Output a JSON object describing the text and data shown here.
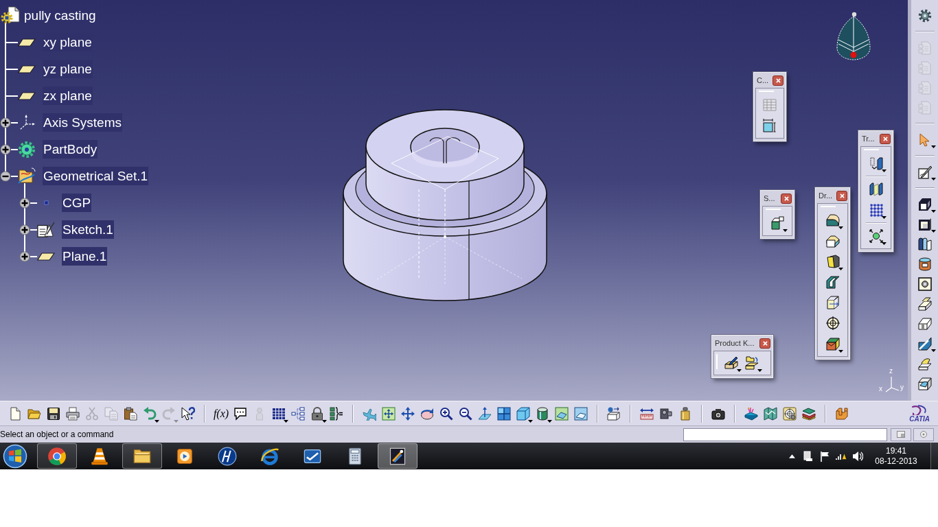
{
  "tree": {
    "label": "pully casting",
    "kind": "part",
    "children": [
      {
        "label": "xy plane",
        "kind": "plane"
      },
      {
        "label": "yz plane",
        "kind": "plane"
      },
      {
        "label": "zx plane",
        "kind": "plane"
      },
      {
        "label": "Axis Systems",
        "kind": "axis_system",
        "expanded": false
      },
      {
        "label": "PartBody",
        "kind": "body",
        "expanded": false
      },
      {
        "label": "Geometrical Set.1",
        "kind": "geometrical_set",
        "expanded": true,
        "children": [
          {
            "label": "CGP",
            "kind": "point",
            "expanded": false
          },
          {
            "label": "Sketch.1",
            "kind": "sketch",
            "expanded": false
          },
          {
            "label": "Plane.1",
            "kind": "plane",
            "expanded": false
          }
        ]
      }
    ]
  },
  "axis_triad": {
    "labels": [
      "z",
      "x",
      "y"
    ]
  },
  "floating_toolbars": [
    {
      "title": "C..."
    },
    {
      "title": "S..."
    },
    {
      "title": "Dr..."
    },
    {
      "title": "Tr..."
    },
    {
      "title": "Product K..."
    }
  ],
  "side_toolbar": [
    [
      {
        "disabled": false
      }
    ],
    [
      {
        "disabled": true
      },
      {
        "disabled": true
      },
      {
        "disabled": true
      },
      {
        "disabled": true
      }
    ],
    [
      {
        "disabled": false
      }
    ],
    [
      {
        "disabled": false
      }
    ],
    [
      {
        "disabled": false
      },
      {
        "disabled": false
      },
      {
        "disabled": false
      },
      {
        "disabled": false
      },
      {
        "disabled": false
      },
      {
        "disabled": false
      },
      {
        "disabled": false
      },
      {
        "disabled": false
      },
      {
        "disabled": false
      },
      {
        "disabled": false
      }
    ]
  ],
  "bottom_toolbar": {
    "groups": [
      [
        {
          "disabled": false
        },
        {
          "disabled": false
        },
        {
          "disabled": false
        },
        {
          "disabled": false
        },
        {
          "disabled": true
        },
        {
          "disabled": true
        },
        {
          "disabled": false
        },
        {
          "disabled": false
        },
        {
          "disabled": true
        },
        {
          "disabled": false
        }
      ],
      [
        {
          "label": "f(x)",
          "disabled": false
        },
        {
          "disabled": false
        },
        {
          "disabled": true
        },
        {
          "disabled": false
        },
        {
          "disabled": false
        },
        {
          "disabled": false
        },
        {
          "disabled": false
        }
      ],
      [
        {
          "disabled": false
        },
        {
          "disabled": false
        },
        {
          "disabled": false
        },
        {
          "disabled": false
        },
        {
          "disabled": false
        },
        {
          "disabled": false
        },
        {
          "disabled": false
        },
        {
          "disabled": false
        },
        {
          "disabled": false
        },
        {
          "disabled": false
        },
        {
          "disabled": false
        },
        {
          "disabled": false
        }
      ],
      [
        {
          "disabled": false
        }
      ],
      [
        {
          "disabled": false
        },
        {
          "disabled": false
        },
        {
          "disabled": false
        }
      ],
      [
        {
          "disabled": false
        }
      ],
      [
        {
          "disabled": false
        },
        {
          "disabled": false
        },
        {
          "disabled": false
        },
        {
          "disabled": false
        }
      ],
      [
        {
          "disabled": false
        }
      ]
    ],
    "logo": "CATIA"
  },
  "status_bar": {
    "prompt": "Select an object or a command"
  },
  "taskbar": {
    "apps": [
      {
        "running": true,
        "selected": false
      },
      {
        "running": false,
        "selected": false
      },
      {
        "running": true,
        "selected": false
      },
      {
        "running": false,
        "selected": false
      },
      {
        "running": false,
        "selected": false
      },
      {
        "running": false,
        "selected": false
      },
      {
        "running": false,
        "selected": false
      },
      {
        "running": false,
        "selected": false
      },
      {
        "running": true,
        "selected": true
      }
    ],
    "clock": {
      "time": "19:41",
      "date": "08-12-2013"
    }
  }
}
